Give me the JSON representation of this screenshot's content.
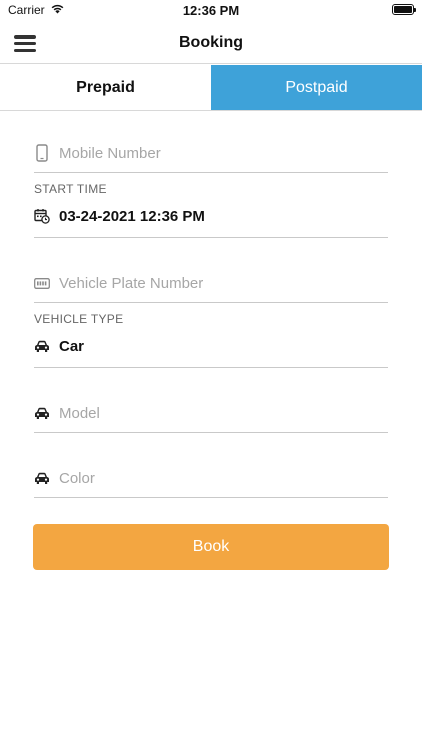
{
  "status_bar": {
    "carrier": "Carrier",
    "time": "12:36 PM",
    "battery_level": 1.0
  },
  "nav": {
    "title": "Booking",
    "menu_icon": "hamburger-menu-icon"
  },
  "tabs": [
    {
      "label": "Prepaid",
      "selected": false
    },
    {
      "label": "Postpaid",
      "selected": true
    }
  ],
  "form": {
    "mobile": {
      "placeholder": "Mobile Number",
      "icon": "mobile-phone-icon"
    },
    "start_time": {
      "label": "START TIME",
      "value": "03-24-2021 12:36 PM",
      "icon": "calendar-clock-icon"
    },
    "plate": {
      "placeholder": "Vehicle Plate Number",
      "icon": "license-plate-icon"
    },
    "vehicle_type": {
      "label": "VEHICLE TYPE",
      "value": "Car",
      "icon": "car-icon"
    },
    "model": {
      "placeholder": "Model",
      "icon": "car-icon"
    },
    "color": {
      "placeholder": "Color",
      "icon": "car-icon"
    }
  },
  "book_button": {
    "label": "Book"
  },
  "colors": {
    "tab_active": "#3ea2d9",
    "book_button": "#f3a641",
    "placeholder": "#a6a6a6"
  }
}
